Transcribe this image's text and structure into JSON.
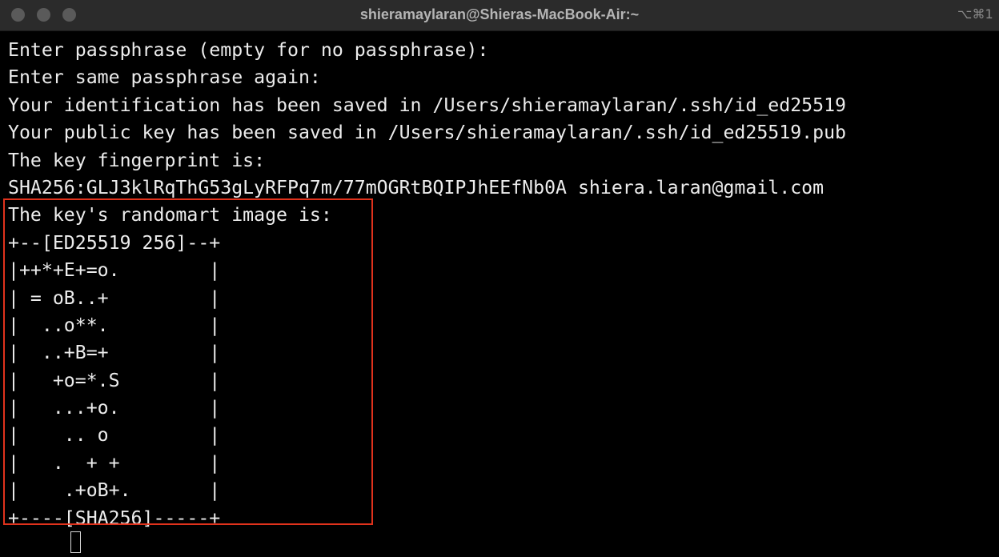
{
  "window": {
    "title": "shieramaylaran@Shieras-MacBook-Air:~",
    "shortcut": "⌥⌘1"
  },
  "terminal": {
    "lines": [
      "Enter passphrase (empty for no passphrase):",
      "Enter same passphrase again:",
      "Your identification has been saved in /Users/shieramaylaran/.ssh/id_ed25519",
      "Your public key has been saved in /Users/shieramaylaran/.ssh/id_ed25519.pub",
      "The key fingerprint is:",
      "SHA256:GLJ3klRqThG53gLyRFPq7m/77mOGRtBQIPJhEEfNb0A shiera.laran@gmail.com",
      "The key's randomart image is:",
      "+--[ED25519 256]--+",
      "|++*+E+=o.        |",
      "| = oB..+         |",
      "|  ..o**.         |",
      "|  ..+B=+         |",
      "|   +o=*.S        |",
      "|   ...+o.        |",
      "|    .. o         |",
      "|   .  + +        |",
      "|    .+oB+.       |",
      "+----[SHA256]-----+"
    ],
    "prompt": {
      "arrow": "➜",
      "directory": "~"
    }
  },
  "colors": {
    "background": "#000000",
    "text": "#ececec",
    "highlight": "#e0321c",
    "prompt_arrow": "#5fd35f",
    "prompt_dir": "#6fd0d8"
  }
}
